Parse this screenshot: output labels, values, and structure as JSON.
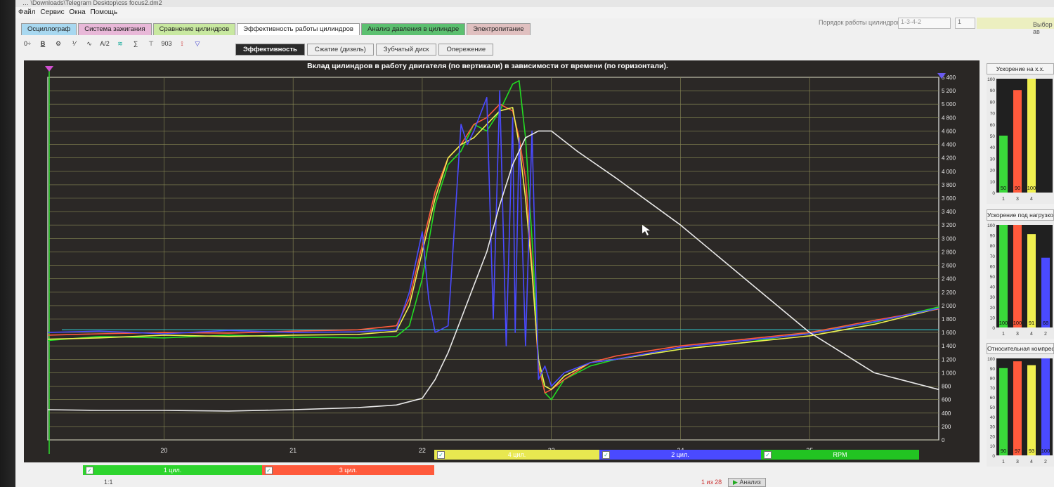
{
  "window": {
    "title": "… \\Downloads\\Telegram Desktop\\css focus2.dm2"
  },
  "menu": [
    "Файл",
    "Сервис",
    "Окна",
    "Помощь"
  ],
  "tabs": [
    {
      "label": "Осциллограф",
      "color": "#a8d8f0"
    },
    {
      "label": "Система зажигания",
      "color": "#e8b8d8"
    },
    {
      "label": "Сравнение цилиндров",
      "color": "#c8e8a0"
    },
    {
      "label": "Эффективность работы цилиндров",
      "color": "#ffffff"
    },
    {
      "label": "Анализ давления в цилиндре",
      "color": "#5cc070"
    },
    {
      "label": "Электропитание",
      "color": "#e0c0c0"
    }
  ],
  "top_right": {
    "order_label": "Порядок работы цилиндров",
    "order_value": "1-3-4-2",
    "num_value": "1",
    "select_label": "Выбор ав"
  },
  "toolbar": [
    "0÷",
    "B",
    "⚙",
    "⅟",
    "∿",
    "A/2",
    "≋",
    "∑",
    "⊤",
    "903",
    "⟟",
    "▽"
  ],
  "subtabs": [
    "Эффективность",
    "Сжатие (дизель)",
    "Зубчатый диск",
    "Опережение"
  ],
  "chart_data": {
    "type": "line",
    "title": "Вклад цилиндров в работу двигателя (по вертикали) в зависимости от времени (по горизонтали).",
    "x_ticks": [
      "20",
      "21",
      "22",
      "23",
      "24",
      "25"
    ],
    "y_right_ticks": [
      "0",
      "200",
      "400",
      "600",
      "800",
      "1 000",
      "1 200",
      "1 400",
      "1 600",
      "1 800",
      "2 000",
      "2 200",
      "2 400",
      "2 600",
      "2 800",
      "3 000",
      "3 200",
      "3 400",
      "3 600",
      "3 800",
      "4 000",
      "4 200",
      "4 400",
      "4 600",
      "4 800",
      "5 000",
      "5 200",
      "5 400"
    ],
    "ylim": [
      0,
      5400
    ],
    "xlim": [
      19.1,
      26.0
    ],
    "series": [
      {
        "name": "1 цил.",
        "color": "#22dd22",
        "x": [
          19.1,
          19.5,
          20.0,
          20.5,
          21.0,
          21.5,
          21.8,
          21.9,
          22.0,
          22.1,
          22.2,
          22.3,
          22.4,
          22.5,
          22.6,
          22.7,
          22.75,
          22.8,
          22.85,
          22.9,
          22.95,
          23.0,
          23.1,
          23.3,
          23.5,
          24.0,
          24.5,
          25.0,
          25.5,
          26.0
        ],
        "y": [
          1480,
          1540,
          1520,
          1560,
          1530,
          1520,
          1540,
          1700,
          2400,
          3500,
          4100,
          4300,
          4700,
          4600,
          4900,
          5300,
          5350,
          4500,
          3000,
          1200,
          700,
          600,
          900,
          1100,
          1200,
          1350,
          1450,
          1600,
          1750,
          1980
        ]
      },
      {
        "name": "3 цил.",
        "color": "#ff5a3c",
        "x": [
          19.1,
          19.5,
          20.0,
          20.5,
          21.0,
          21.5,
          21.8,
          21.9,
          22.0,
          22.1,
          22.2,
          22.3,
          22.4,
          22.5,
          22.6,
          22.7,
          22.75,
          22.8,
          22.85,
          22.9,
          22.95,
          23.0,
          23.1,
          23.3,
          23.5,
          24.0,
          24.5,
          25.0,
          25.5,
          26.0
        ],
        "y": [
          1560,
          1580,
          1600,
          1590,
          1620,
          1640,
          1700,
          2100,
          2900,
          3700,
          4200,
          4400,
          4700,
          4800,
          5000,
          4900,
          4500,
          3900,
          2600,
          1100,
          700,
          750,
          900,
          1150,
          1250,
          1400,
          1500,
          1600,
          1780,
          1950
        ]
      },
      {
        "name": "4 цил.",
        "color": "#f0f050",
        "x": [
          19.1,
          19.5,
          20.0,
          20.5,
          21.0,
          21.5,
          21.8,
          21.9,
          22.0,
          22.1,
          22.2,
          22.3,
          22.4,
          22.5,
          22.6,
          22.7,
          22.75,
          22.8,
          22.85,
          22.9,
          22.95,
          23.0,
          23.1,
          23.3,
          23.5,
          24.0,
          24.5,
          25.0,
          25.5,
          26.0
        ],
        "y": [
          1500,
          1520,
          1560,
          1540,
          1560,
          1570,
          1620,
          2000,
          2800,
          3600,
          4200,
          4400,
          4500,
          4700,
          4900,
          4950,
          4400,
          3600,
          2500,
          1200,
          800,
          750,
          950,
          1150,
          1200,
          1350,
          1450,
          1550,
          1720,
          1960
        ]
      },
      {
        "name": "2 цил.",
        "color": "#4a4aff",
        "x": [
          19.1,
          19.5,
          20.0,
          20.5,
          21.0,
          21.5,
          21.8,
          21.9,
          22.0,
          22.05,
          22.1,
          22.2,
          22.3,
          22.35,
          22.4,
          22.5,
          22.55,
          22.6,
          22.65,
          22.7,
          22.72,
          22.75,
          22.8,
          22.85,
          22.9,
          22.95,
          23.0,
          23.1,
          23.3,
          23.5,
          24.0,
          24.5,
          25.0,
          25.5,
          26.0
        ],
        "y": [
          1600,
          1620,
          1580,
          1630,
          1600,
          1610,
          1640,
          2200,
          3100,
          2100,
          1600,
          1700,
          4700,
          4400,
          4600,
          5100,
          1800,
          5200,
          1400,
          4800,
          1600,
          4500,
          1400,
          4600,
          900,
          1100,
          800,
          1000,
          1150,
          1200,
          1380,
          1480,
          1580,
          1760,
          1960
        ]
      },
      {
        "name": "RPM",
        "color": "#e8e8e8",
        "x": [
          19.1,
          19.5,
          20.0,
          20.5,
          21.0,
          21.5,
          21.8,
          22.0,
          22.1,
          22.2,
          22.3,
          22.4,
          22.5,
          22.6,
          22.7,
          22.8,
          22.9,
          23.0,
          23.2,
          23.5,
          24.0,
          24.5,
          25.0,
          25.5,
          26.0
        ],
        "y": [
          450,
          440,
          440,
          430,
          450,
          480,
          520,
          620,
          900,
          1300,
          1800,
          2300,
          2800,
          3500,
          4100,
          4500,
          4600,
          4600,
          4300,
          3900,
          3200,
          2400,
          1600,
          1000,
          750
        ]
      }
    ],
    "reference_line": {
      "name": "cyan",
      "color": "#30c8d0",
      "y": 1640
    }
  },
  "side_panels": [
    {
      "title": "Ускорение на х.х.",
      "labels": [
        "1",
        "3",
        "4"
      ],
      "values": [
        50,
        90,
        100
      ],
      "colors": [
        "#3ad83a",
        "#ff5a3c",
        "#f0f050"
      ],
      "axis": [
        "0",
        "10",
        "20",
        "30",
        "40",
        "50",
        "60",
        "70",
        "80",
        "90",
        "100"
      ]
    },
    {
      "title": "Ускорение под нагрузкой",
      "labels": [
        "1",
        "3",
        "4",
        "2"
      ],
      "values": [
        100,
        100,
        91,
        68
      ],
      "colors": [
        "#3ad83a",
        "#ff5a3c",
        "#f0f050",
        "#4a4aff"
      ],
      "axis": [
        "0",
        "10",
        "20",
        "30",
        "40",
        "50",
        "60",
        "70",
        "80",
        "90",
        "100"
      ]
    },
    {
      "title": "Относительная компрессия %",
      "labels": [
        "1",
        "3",
        "4",
        "2"
      ],
      "values": [
        90,
        97,
        93,
        100
      ],
      "colors": [
        "#3ad83a",
        "#ff5a3c",
        "#f0f050",
        "#4a4aff"
      ],
      "axis": [
        "0",
        "10",
        "20",
        "30",
        "40",
        "50",
        "60",
        "70",
        "80",
        "90",
        "100"
      ]
    }
  ],
  "bottom_tabs": [
    {
      "label": "1 цил.",
      "color": "#2ed42e"
    },
    {
      "label": "3 цил.",
      "color": "#ff5a3c"
    },
    {
      "label": "4 цил.",
      "color": "#e8e850"
    },
    {
      "label": "2 цил.",
      "color": "#4a4aff"
    },
    {
      "label": "RPM",
      "color": "#22c422"
    }
  ],
  "status": {
    "zoom": "1:1",
    "counter": "1 из 28",
    "analyze_label": "Анализ"
  }
}
